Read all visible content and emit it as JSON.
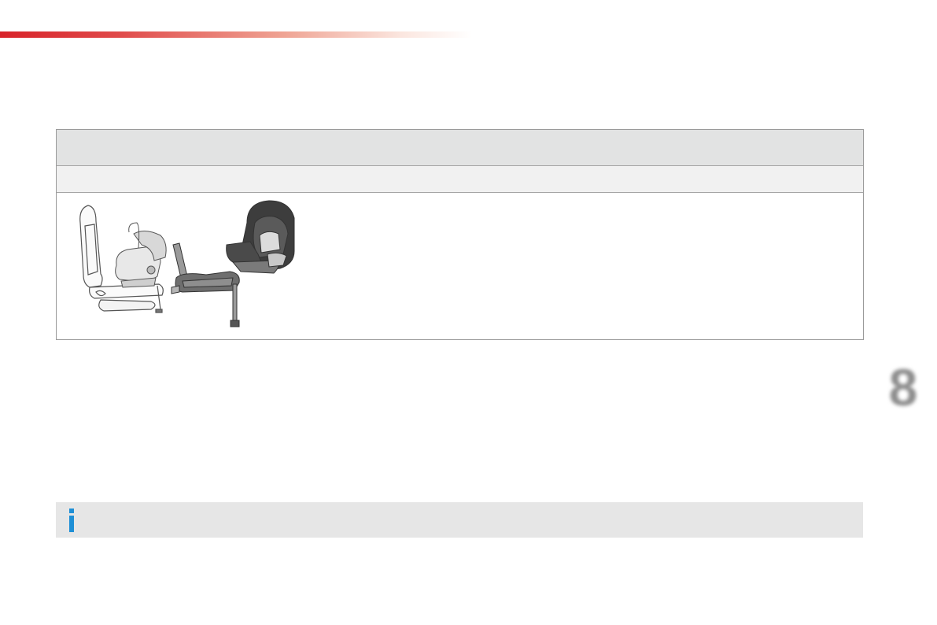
{
  "chapter": {
    "number": "8"
  },
  "table": {
    "header": "",
    "subheader": "",
    "illustration_icon": "isofix-baby-seat-illustration"
  },
  "info": {
    "icon": "info-icon",
    "text": ""
  },
  "colors": {
    "accent_red": "#d8232a",
    "table_header_bg": "#e2e3e3",
    "table_sub_bg": "#f1f1f1",
    "info_bg": "#e6e6e6",
    "info_icon_blue": "#1e8fd6"
  }
}
